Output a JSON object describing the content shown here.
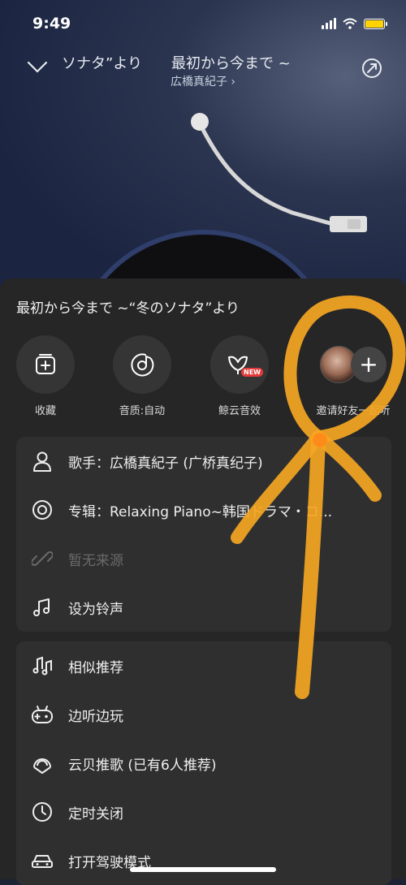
{
  "status_bar": {
    "time": "9:49"
  },
  "header": {
    "song_title": "ｿﾅﾀ”より　　最初から今まで ~",
    "song_title_full": "ソナタ”より　　最初から今まで ~",
    "artist_link": "広橋真紀子 ›"
  },
  "sheet": {
    "title": "最初から今まで ~“冬のソナタ”より",
    "actions": [
      {
        "label": "收藏",
        "icon": "add-to-playlist-icon"
      },
      {
        "label": "音质:自动",
        "icon": "quality-icon"
      },
      {
        "label": "鲸云音效",
        "icon": "whale-sound-icon",
        "badge": "NEW"
      },
      {
        "label": "邀请好友一起听",
        "icon": "invite-plus-icon"
      }
    ],
    "info_rows": [
      {
        "label": "歌手：広橋真紀子 (广桥真纪子)",
        "icon": "person-icon"
      },
      {
        "label": "专辑：Relaxing Piano~韩国ドラマ・コ...",
        "icon": "album-icon"
      },
      {
        "label": "暂无来源",
        "icon": "link-icon",
        "disabled": true
      },
      {
        "label": "设为铃声",
        "icon": "ringtone-icon"
      }
    ],
    "more_rows": [
      {
        "label": "相似推荐",
        "icon": "similar-music-icon"
      },
      {
        "label": "边听边玩",
        "icon": "gamepad-icon"
      },
      {
        "label": "云贝推歌 (已有6人推荐)",
        "icon": "cloud-shell-icon"
      },
      {
        "label": "定时关闭",
        "icon": "clock-icon"
      },
      {
        "label": "打开驾驶模式",
        "icon": "car-icon"
      }
    ]
  },
  "colors": {
    "sheet_bg": "#262626",
    "card_bg": "#2f2f2f",
    "annotation": "#f5a623",
    "badge": "#e43a3a"
  }
}
